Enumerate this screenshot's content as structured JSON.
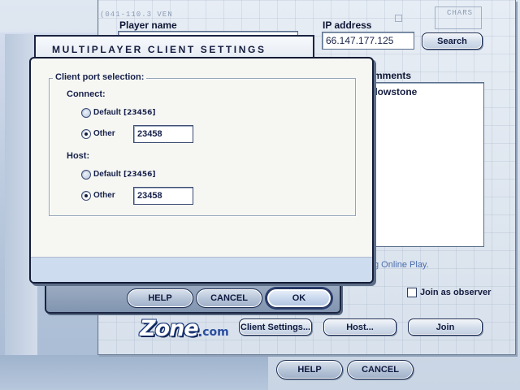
{
  "lobby": {
    "player_name_label": "Player name",
    "player_name_value": "",
    "ip_label": "IP address",
    "ip_value": "66.147.177.125",
    "search_label": "Search",
    "comments_label": "Comments",
    "list_first_entry": "Yellowstone",
    "online_play_note": "Using Online Play.",
    "observer_label": "Join as observer",
    "client_settings_label": "Client Settings...",
    "host_label": "Host...",
    "join_label": "Join",
    "help_label": "HELP",
    "cancel_label": "CANCEL",
    "blueprint_marks": {
      "top_left": "(041-110.3 VEN",
      "top_right": "CHARS"
    }
  },
  "logo": {
    "main": "Zone",
    "dot": ".",
    "suffix": "com"
  },
  "dialog": {
    "title": "MULTIPLAYER CLIENT SETTINGS",
    "group_title": "Client port selection:",
    "connect": {
      "label": "Connect:",
      "default_label": "Default",
      "default_port": "[23456]",
      "other_label": "Other",
      "other_value": "23458",
      "selected": "other"
    },
    "host": {
      "label": "Host:",
      "default_label": "Default",
      "default_port": "[23456]",
      "other_label": "Other",
      "other_value": "23458",
      "selected": "other"
    },
    "help_label": "HELP",
    "cancel_label": "CANCEL",
    "ok_label": "OK"
  },
  "colors": {
    "accent_navy": "#1b2442",
    "dialog_face": "#f6f7f3",
    "footer_blue": "#cddcef",
    "link_blue": "#4b6fae"
  }
}
